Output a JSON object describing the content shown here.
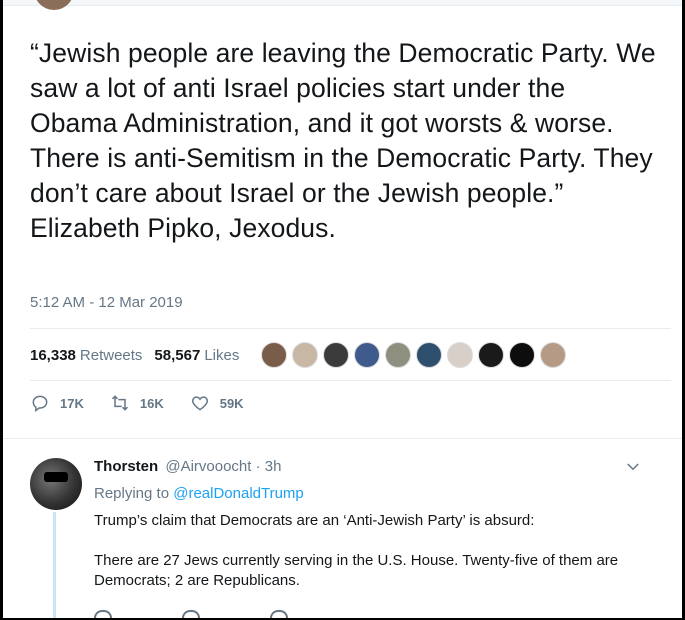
{
  "tweet": {
    "text": "“Jewish people are leaving the Democratic Party. We saw a lot of anti Israel policies start under the Obama Administration, and it got worsts & worse. There is anti-Semitism in the Democratic Party. They don’t care about Israel or the Jewish people.” Elizabeth Pipko, Jexodus.",
    "timestamp": "5:12 AM - 12 Mar 2019",
    "retweets_count": "16,338",
    "retweets_label": "Retweets",
    "likes_count": "58,567",
    "likes_label": "Likes"
  },
  "likers": [
    {
      "color": "#7a5c4a"
    },
    {
      "color": "#c9b7a6"
    },
    {
      "color": "#3b3b3b"
    },
    {
      "color": "#3f5a8c"
    },
    {
      "color": "#8f8f80"
    },
    {
      "color": "#2f4f6f"
    },
    {
      "color": "#d8d0c8"
    },
    {
      "color": "#1a1a1a"
    },
    {
      "color": "#0d0d0d"
    },
    {
      "color": "#b59a86"
    }
  ],
  "actions": {
    "replies": "17K",
    "retweets": "16K",
    "likes": "59K"
  },
  "reply": {
    "name": "Thorsten",
    "handle": "@Airvooocht · 3h",
    "replying_prefix": "Replying to",
    "replying_to": "@realDonaldTrump",
    "paragraph_1": "Trump’s claim that Democrats are an ‘Anti-Jewish Party’ is absurd:",
    "paragraph_2": "There are 27 Jews currently serving in the U.S. House. Twenty-five of them are Democrats; 2 are Republicans."
  },
  "colors": {
    "link": "#1da1f2",
    "muted": "#657786",
    "text": "#14171a"
  }
}
